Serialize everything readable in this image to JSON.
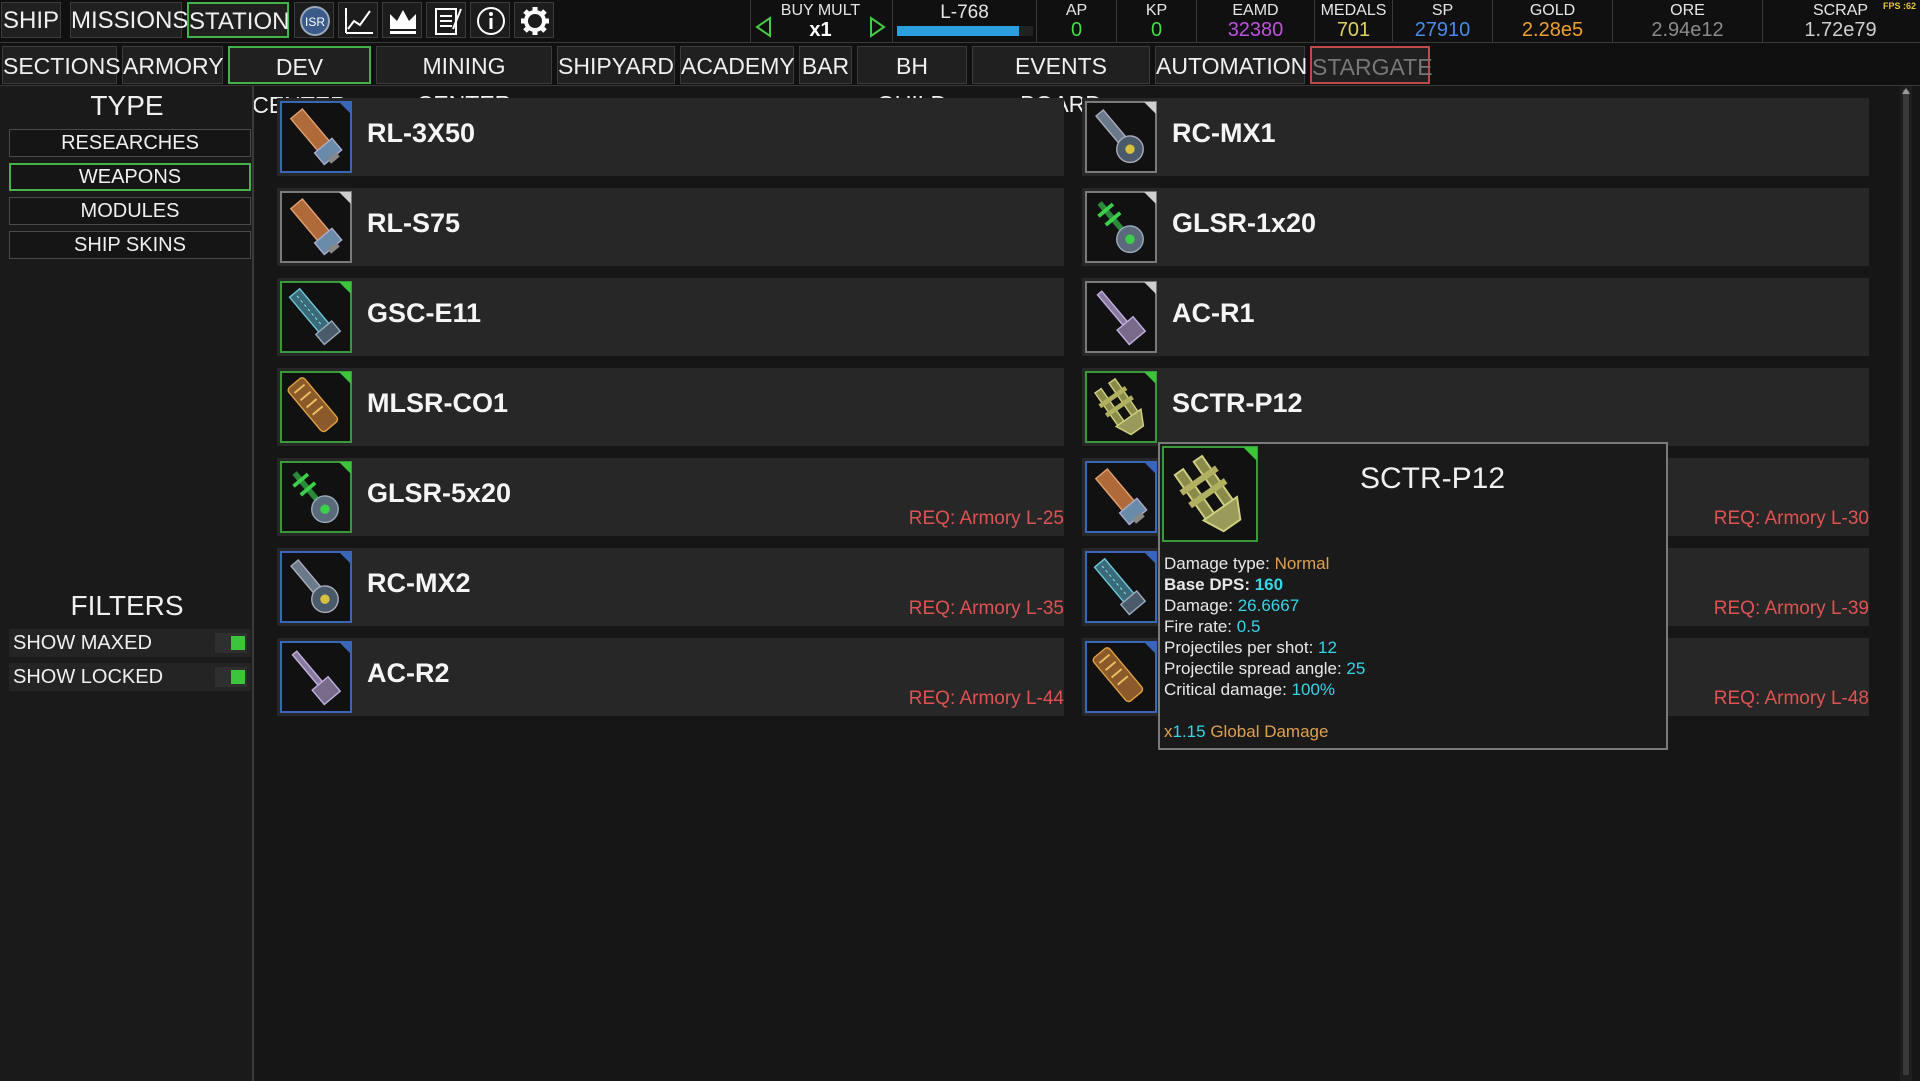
{
  "topbar": {
    "tabs": [
      "SHIP",
      "MISSIONS",
      "STATION"
    ],
    "active_tab": "STATION",
    "isr_label": "ISR",
    "buy_mult": {
      "label": "BUY MULT",
      "value": "x1"
    },
    "level": {
      "label": "L-768",
      "progress": 0.9
    },
    "stats": [
      {
        "label": "AP",
        "value": "0",
        "color": "#44dd44"
      },
      {
        "label": "KP",
        "value": "0",
        "color": "#44dd44"
      },
      {
        "label": "EAMD",
        "value": "32380",
        "color": "#c050e0"
      },
      {
        "label": "MEDALS",
        "value": "701",
        "color": "#e0d060"
      },
      {
        "label": "SP",
        "value": "27910",
        "color": "#4a8ae8"
      },
      {
        "label": "GOLD",
        "value": "2.28e5",
        "color": "#f0a030"
      },
      {
        "label": "ORE",
        "value": "2.94e12",
        "color": "#8a8a8a"
      },
      {
        "label": "SCRAP",
        "value": "1.72e79",
        "color": "#cfcfcf"
      }
    ],
    "fps_label": "FPS :62"
  },
  "sections": {
    "tabs": [
      "SECTIONS",
      "ARMORY",
      "DEV CENTER",
      "MINING CENTER",
      "SHIPYARD",
      "ACADEMY",
      "BAR",
      "BH GUILD",
      "EVENTS BOARD",
      "AUTOMATION",
      "STARGATE"
    ],
    "active_tab": "DEV CENTER",
    "locked_tab": "STARGATE"
  },
  "left_panel": {
    "type_title": "TYPE",
    "types": [
      "RESEARCHES",
      "WEAPONS",
      "MODULES",
      "SHIP SKINS"
    ],
    "active_type": "WEAPONS",
    "filters_title": "FILTERS",
    "filters": [
      {
        "label": "SHOW MAXED",
        "on": true
      },
      {
        "label": "SHOW LOCKED",
        "on": true
      }
    ]
  },
  "weapons": [
    {
      "name": "RL-3X50",
      "req": "",
      "border": "blue",
      "icon": "rocket-launcher-icon"
    },
    {
      "name": "RC-MX1",
      "req": "",
      "border": "gray",
      "icon": "railcannon-icon"
    },
    {
      "name": "RL-S75",
      "req": "",
      "border": "gray",
      "icon": "rocket-launcher-icon"
    },
    {
      "name": "GLSR-1x20",
      "req": "",
      "border": "gray",
      "icon": "green-laser-icon"
    },
    {
      "name": "GSC-E11",
      "req": "",
      "border": "green",
      "icon": "gauss-cannon-icon"
    },
    {
      "name": "AC-R1",
      "req": "",
      "border": "gray",
      "icon": "autocannon-icon"
    },
    {
      "name": "MLSR-CO1",
      "req": "",
      "border": "green",
      "icon": "mining-laser-icon"
    },
    {
      "name": "SCTR-P12",
      "req": "",
      "border": "green",
      "icon": "scatter-gun-icon"
    },
    {
      "name": "GLSR-5x20",
      "req": "REQ: Armory L-25",
      "border": "green",
      "icon": "green-laser-icon"
    },
    {
      "name": "",
      "req": "REQ: Armory L-30",
      "border": "blue",
      "icon": "rocket-launcher-icon"
    },
    {
      "name": "RC-MX2",
      "req": "REQ: Armory L-35",
      "border": "blue",
      "icon": "railcannon-icon"
    },
    {
      "name": "",
      "req": "REQ: Armory L-39",
      "border": "blue",
      "icon": "gauss-cannon-icon"
    },
    {
      "name": "AC-R2",
      "req": "REQ: Armory L-44",
      "border": "blue",
      "icon": "autocannon-icon"
    },
    {
      "name": "",
      "req": "REQ: Armory L-48",
      "border": "blue",
      "icon": "mining-laser-icon"
    }
  ],
  "tooltip": {
    "title": "SCTR-P12",
    "icon": "scatter-gun-icon",
    "damage_type_label": "Damage type:",
    "damage_type": "Normal",
    "base_dps_label": "Base DPS:",
    "base_dps": "160",
    "damage_label": "Damage:",
    "damage": "26.6667",
    "fire_rate_label": "Fire rate:",
    "fire_rate": "0.5",
    "projectiles_label": "Projectiles per shot:",
    "projectiles": "12",
    "spread_label": "Projectile spread angle:",
    "spread": "25",
    "crit_label": "Critical damage:",
    "crit": "100%",
    "bonus_prefix": "x",
    "bonus_value": "1.15",
    "bonus_label": "Global Damage"
  },
  "colors": {
    "accent_green": "#44b44a",
    "req_red": "#e05252",
    "tooltip_value_cyan": "#35d6e8",
    "tooltip_value_orange": "#e0a050"
  }
}
